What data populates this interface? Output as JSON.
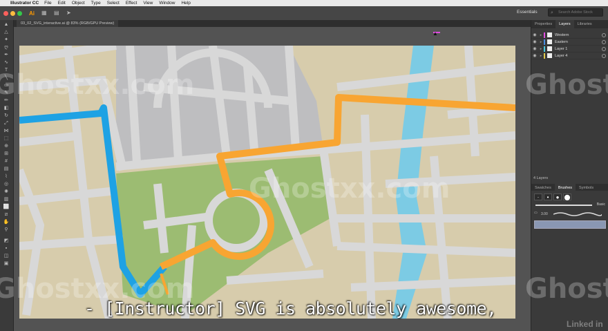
{
  "menubar": {
    "app_name": "Illustrator CC",
    "items": [
      "File",
      "Edit",
      "Object",
      "Type",
      "Select",
      "Effect",
      "View",
      "Window",
      "Help"
    ]
  },
  "appbar": {
    "logo": "Ai",
    "workspace": "Essentials",
    "search_placeholder": "Search Adobe Stock"
  },
  "document": {
    "tab_label": "03_02_SVG_interactive.ai @ 83% (RGB/GPU Preview)"
  },
  "panels": {
    "top_tabs": [
      "Properties",
      "Layers",
      "Libraries"
    ],
    "layers": [
      {
        "name": "Western",
        "color": "#e04ce0"
      },
      {
        "name": "Eastern",
        "color": "#4a8de0"
      },
      {
        "name": "Layer 1",
        "color": "#4ac9e0"
      },
      {
        "name": "Layer 4",
        "color": "#e0c84a"
      }
    ],
    "layers_count": "4 Layers",
    "bottom_tabs": [
      "Swatches",
      "Brushes",
      "Symbols"
    ],
    "brush_basic_label": "Basic",
    "brush_size": "3.00"
  },
  "colors": {
    "blue_route": "#1ea2e4",
    "orange_route": "#f8a532",
    "river": "#7ccbe4",
    "block": "#d7ccac",
    "gray_block": "#bebec0",
    "green_block": "#9cbc72",
    "road": "#d8d8d8"
  },
  "watermark": "Ghostxx.com",
  "caption": "- [Instructor] SVG is absolutely awesome,",
  "brand": "Linked in"
}
